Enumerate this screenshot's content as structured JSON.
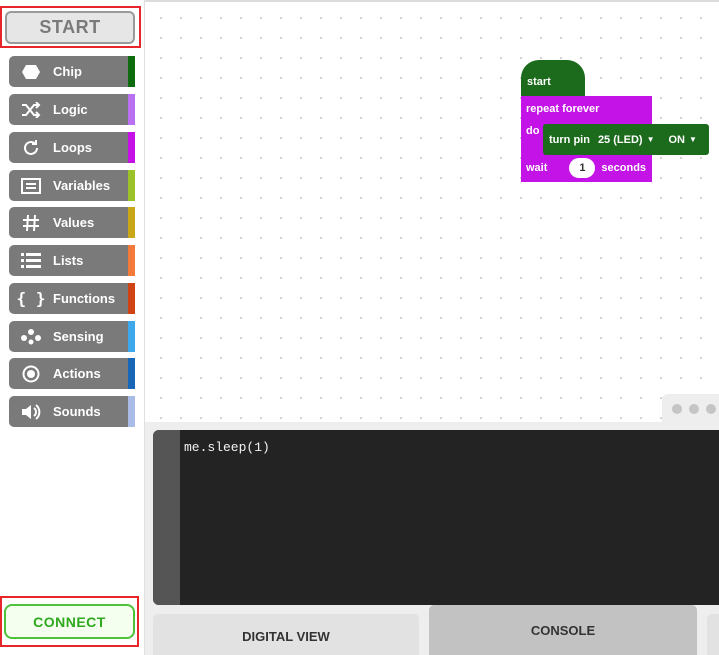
{
  "sidebar": {
    "start_label": "START",
    "connect_label": "CONNECT",
    "categories": [
      {
        "label": "Chip",
        "icon": "hexagon-icon",
        "color": "#0e6b0e"
      },
      {
        "label": "Logic",
        "icon": "shuffle-icon",
        "color": "#b970f2"
      },
      {
        "label": "Loops",
        "icon": "loop-arrow-icon",
        "color": "#c511e8"
      },
      {
        "label": "Variables",
        "icon": "variable-box-icon",
        "color": "#9cc22a"
      },
      {
        "label": "Values",
        "icon": "hash-icon",
        "color": "#c9a716"
      },
      {
        "label": "Lists",
        "icon": "list-icon",
        "color": "#f47a3a"
      },
      {
        "label": "Functions",
        "icon": "braces-icon",
        "color": "#d04314"
      },
      {
        "label": "Sensing",
        "icon": "sensing-dots-icon",
        "color": "#3ea8ec"
      },
      {
        "label": "Actions",
        "icon": "target-icon",
        "color": "#1866b8"
      },
      {
        "label": "Sounds",
        "icon": "speaker-icon",
        "color": "#a9bce8"
      }
    ]
  },
  "workspace": {
    "blocks": {
      "start": "start",
      "repeat": "repeat forever",
      "do": "do",
      "turn_pin": "turn pin",
      "pin_value": "25 (LED)",
      "state_value": "ON",
      "wait": "wait",
      "wait_value": "1",
      "seconds": "seconds"
    }
  },
  "console": {
    "code": "me.sleep(1)"
  },
  "tabs": {
    "digital": "DIGITAL VIEW",
    "console": "CONSOLE"
  }
}
